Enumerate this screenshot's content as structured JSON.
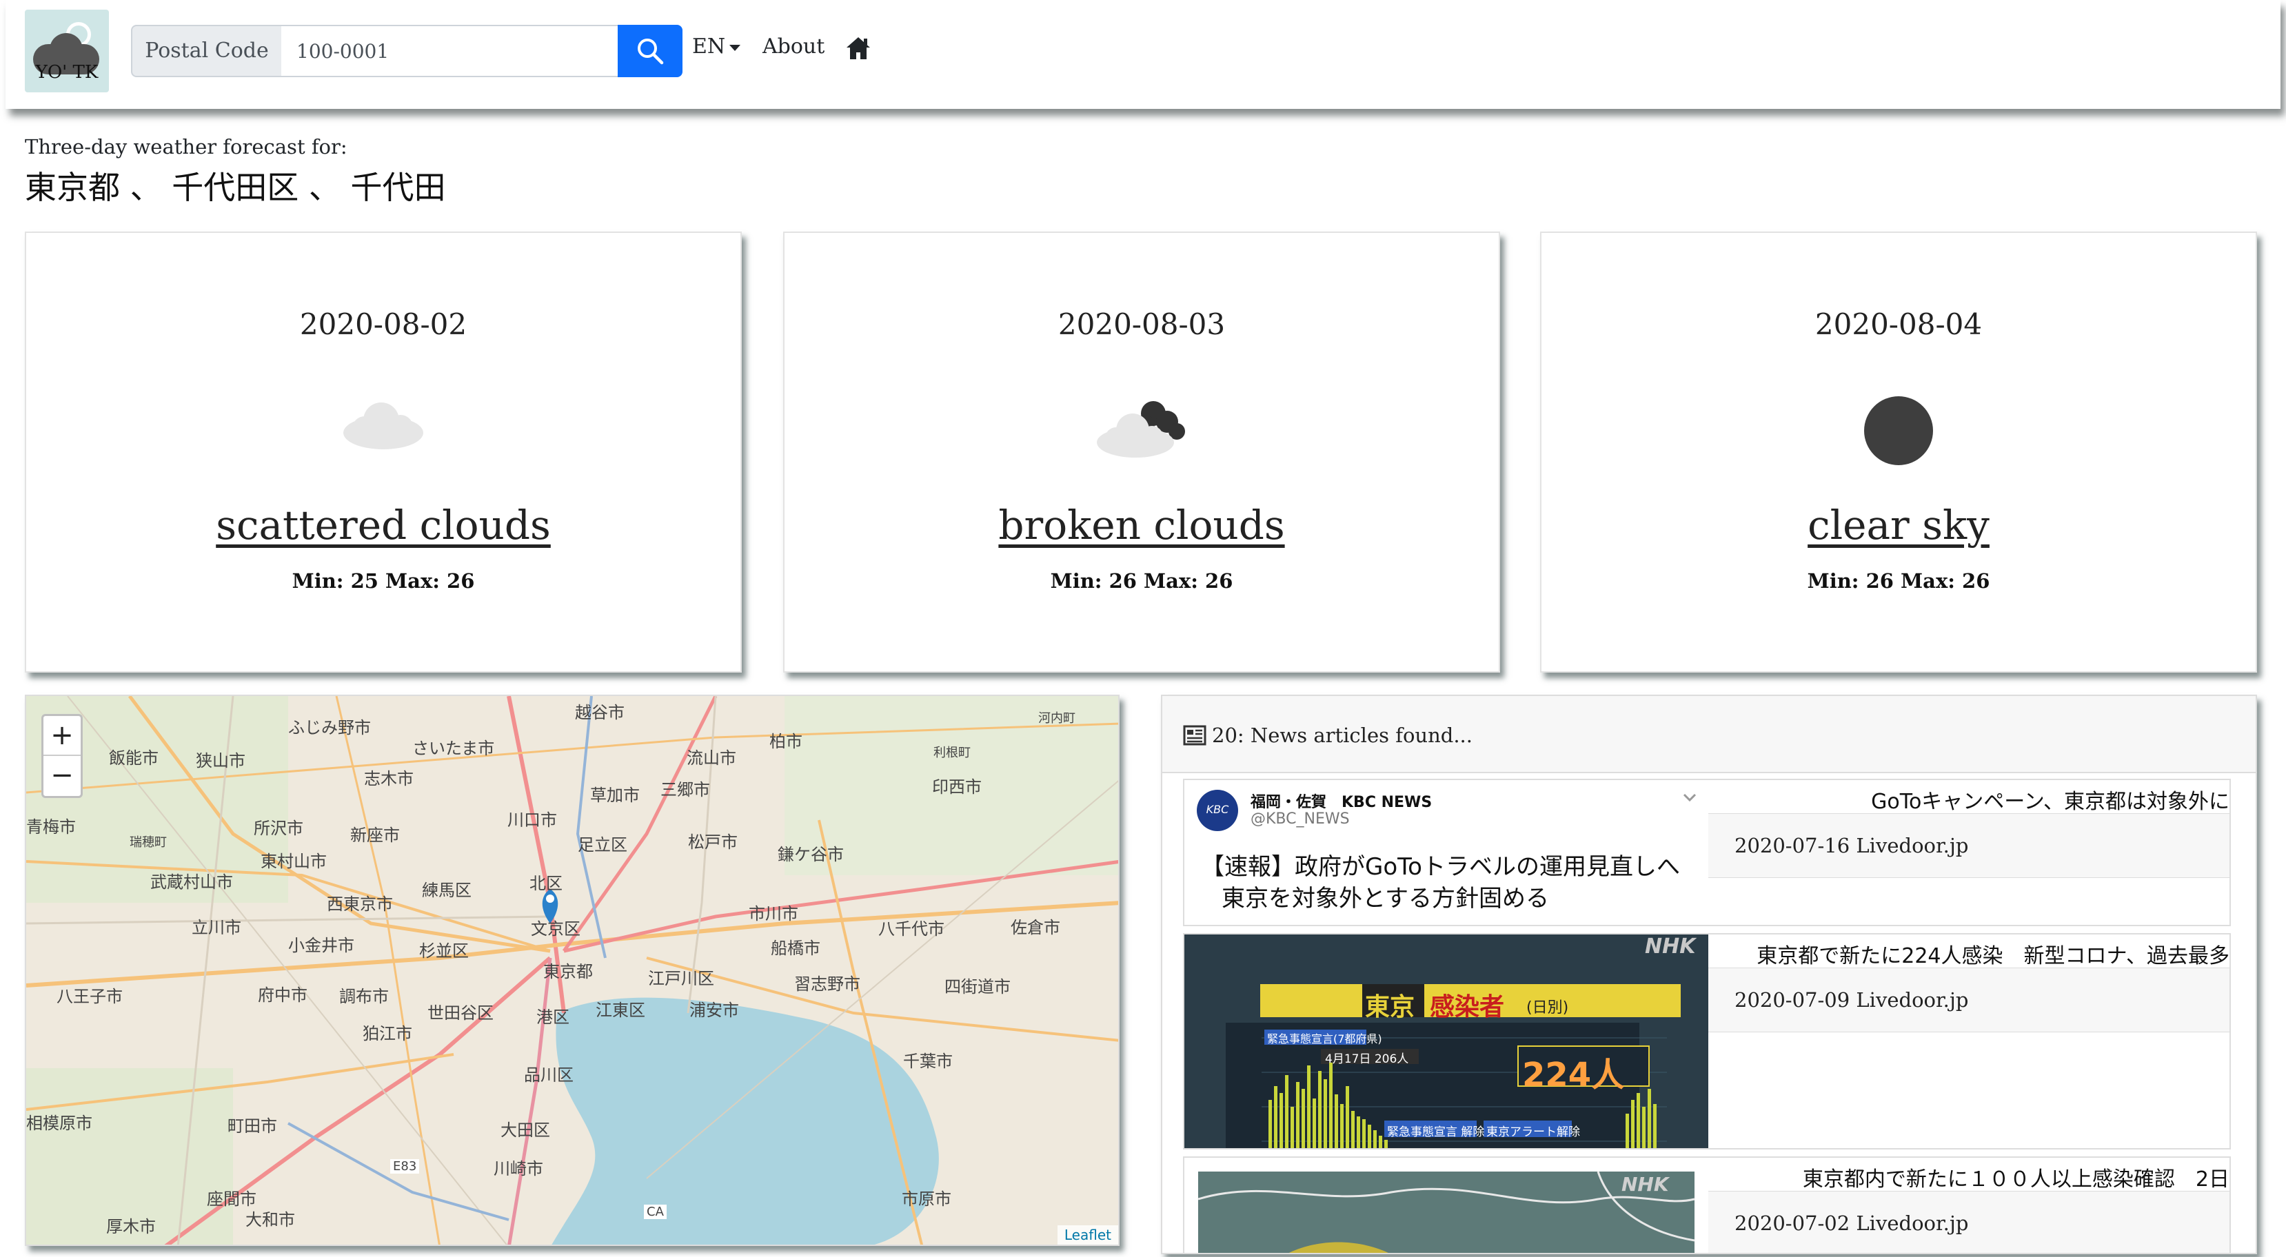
{
  "navbar": {
    "logo_text": "YO' TK",
    "postal_label": "Postal Code",
    "postal_value": "100-0001",
    "lang": "EN",
    "about": "About"
  },
  "header": {
    "subtitle": "Three-day weather forecast for:",
    "location": "東京都 、 千代田区 、 千代田"
  },
  "forecast": [
    {
      "date": "2020-08-02",
      "icon": "scattered-clouds-icon",
      "desc": "scattered clouds",
      "temp": "Min: 25 Max: 26"
    },
    {
      "date": "2020-08-03",
      "icon": "broken-clouds-icon",
      "desc": "broken clouds",
      "temp": "Min: 26 Max: 26"
    },
    {
      "date": "2020-08-04",
      "icon": "clear-sky-icon",
      "desc": "clear sky",
      "temp": "Min: 26 Max: 26"
    }
  ],
  "map": {
    "zoom_in": "+",
    "zoom_out": "−",
    "attribution": "Leaflet",
    "labels": [
      "越谷市",
      "ふじみ野市",
      "さいたま市",
      "柏市",
      "河内町",
      "飯能市",
      "狭山市",
      "志木市",
      "流山市",
      "利根町",
      "草加市",
      "三郷市",
      "印西市",
      "青梅市",
      "所沢市",
      "新座市",
      "川口市",
      "足立区",
      "松戸市",
      "鎌ケ谷市",
      "瑞穂町",
      "東村山市",
      "武蔵村山市",
      "西東京市",
      "練馬区",
      "北区",
      "市川市",
      "八千代市",
      "佐倉市",
      "立川市",
      "小金井市",
      "杉並区",
      "文京区",
      "船橋市",
      "八王子市",
      "府中市",
      "調布市",
      "世田谷区",
      "東京都",
      "江戸川区",
      "浦安市",
      "習志野市",
      "四街道市",
      "狛江市",
      "港区",
      "江東区",
      "千葉市",
      "品川区",
      "相模原市",
      "町田市",
      "大田区",
      "川崎市",
      "座間市",
      "大和市",
      "市原市",
      "厚木市",
      "E83",
      "CA"
    ]
  },
  "news": {
    "header": "20: News articles found...",
    "articles": [
      {
        "title": "GoToキャンペーン、東京都は対象外に",
        "meta": "2020-07-16 Livedoor.jp",
        "tweet_source": "福岡・佐賀　KBC NEWS",
        "tweet_handle": "@KBC_NEWS",
        "tweet_line1": "【速報】政府がGoToトラベルの運用見直しへ",
        "tweet_line2": "東京を対象外とする方針固める"
      },
      {
        "title": "東京都で新たに224人感染　新型コロナ、過去最多",
        "meta": "2020-07-09 Livedoor.jp",
        "tv_logo": "NHK",
        "banner_city": "東京",
        "banner_text": "感染者",
        "banner_unit": "(日別)",
        "count": "224人",
        "tag1": "緊急事態宣言(7都府県)",
        "tag2": "4月17日 206人",
        "tag3": "緊急事態宣言 解除",
        "tag4": "東京アラート解除"
      },
      {
        "title": "東京都内で新たに１００人以上感染確認　2日",
        "meta": "2020-07-02 Livedoor.jp",
        "tv_logo": "NHK"
      }
    ]
  }
}
